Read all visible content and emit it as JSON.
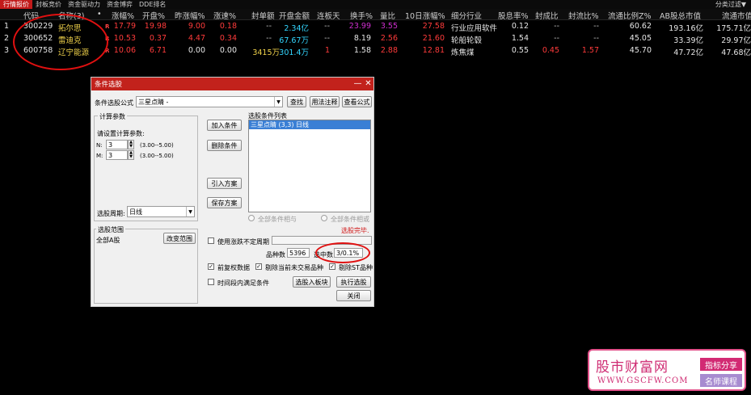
{
  "tabs": [
    "行情报价",
    "封板竞价",
    "资金驱动力",
    "资金博弈",
    "DDE排名"
  ],
  "filter_label": "分类过滤▼",
  "table": {
    "headers": [
      "代码",
      "名称(3)",
      "•",
      "涨幅%",
      "开盘%",
      "昨涨幅%",
      "涨速%",
      "封单额",
      "开盘金额",
      "连板天",
      "换手%",
      "量比",
      "10日涨幅%",
      "细分行业",
      "股息率%",
      "封成比",
      "封流比%",
      "流通比例Z%",
      "AB股总市值",
      "流通市值"
    ],
    "rows": [
      {
        "idx": "1",
        "code": "300229",
        "name": "拓尔思",
        "flag": "R",
        "chg": "17.79",
        "open": "19.98",
        "prev": "9.00",
        "speed": "0.18",
        "seal": "--",
        "openamt": "2.34亿",
        "limit": "--",
        "turn": "23.99",
        "vol": "3.55",
        "d10": "27.58",
        "ind": "行业应用软件",
        "div": "0.12",
        "sc": "--",
        "sf": "--",
        "flr": "60.62",
        "ab": "193.16亿",
        "fmv": "175.71亿"
      },
      {
        "idx": "2",
        "code": "300652",
        "name": "雷迪克",
        "flag": "R",
        "chg": "10.53",
        "open": "0.37",
        "prev": "4.47",
        "speed": "0.34",
        "seal": "--",
        "openamt": "67.67万",
        "limit": "--",
        "turn": "8.19",
        "vol": "2.56",
        "d10": "21.60",
        "ind": "轮船轮毂",
        "div": "1.54",
        "sc": "--",
        "sf": "--",
        "flr": "45.05",
        "ab": "33.39亿",
        "fmv": "29.97亿"
      },
      {
        "idx": "3",
        "code": "600758",
        "name": "辽宁能源",
        "flag": "R",
        "chg": "10.06",
        "open": "6.71",
        "prev": "0.00",
        "speed": "0.00",
        "seal": "3415万",
        "openamt": "301.4万",
        "limit": "1",
        "turn": "1.58",
        "vol": "2.88",
        "d10": "12.81",
        "ind": "炼焦煤",
        "div": "0.55",
        "sc": "0.45",
        "sf": "1.57",
        "flr": "45.70",
        "ab": "47.72亿",
        "fmv": "47.68亿"
      }
    ]
  },
  "dialog": {
    "title": "条件选股",
    "formula_label": "条件选股公式",
    "formula_value": "三星点睛 -",
    "find": "查找",
    "usage": "用法注释",
    "view_formula": "查看公式",
    "params_group": "计算参数",
    "params_prompt": "请设置计算参数:",
    "params": [
      {
        "label": "N:",
        "value": "3",
        "range": "(3.00--5.00)"
      },
      {
        "label": "M:",
        "value": "3",
        "range": "(3.00--5.00)"
      }
    ],
    "period_label": "选股周期:",
    "period_value": "日线",
    "add_cond": "加入条件",
    "del_cond": "删除条件",
    "import_scheme": "引入方案",
    "save_scheme": "保存方案",
    "list_label": "选股条件列表",
    "list_items": [
      "三星点睛 (3,3) 日线"
    ],
    "radio_and": "全部条件相与",
    "radio_or": "全部条件相或",
    "status": "选股完毕.",
    "range_group": "选股范围",
    "range_value": "全部A股",
    "change_range": "改变范围",
    "use_period": "使用涨跌不定周期",
    "total_label": "品种数",
    "total_value": "5396",
    "selected_label": "选中数",
    "selected_value": "3/0.1%",
    "fq": "前复权数据",
    "remove_inactive": "剔除当前未交易品种",
    "remove_st": "剔除ST品种",
    "time_cond": "时间段内满足条件",
    "to_block": "选股入板块",
    "execute": "执行选股",
    "close": "关闭"
  },
  "watermark": {
    "title": "股市财富网",
    "url": "WWW.GSCFW.COM",
    "badge1": "指标分享",
    "badge2": "名师课程"
  }
}
